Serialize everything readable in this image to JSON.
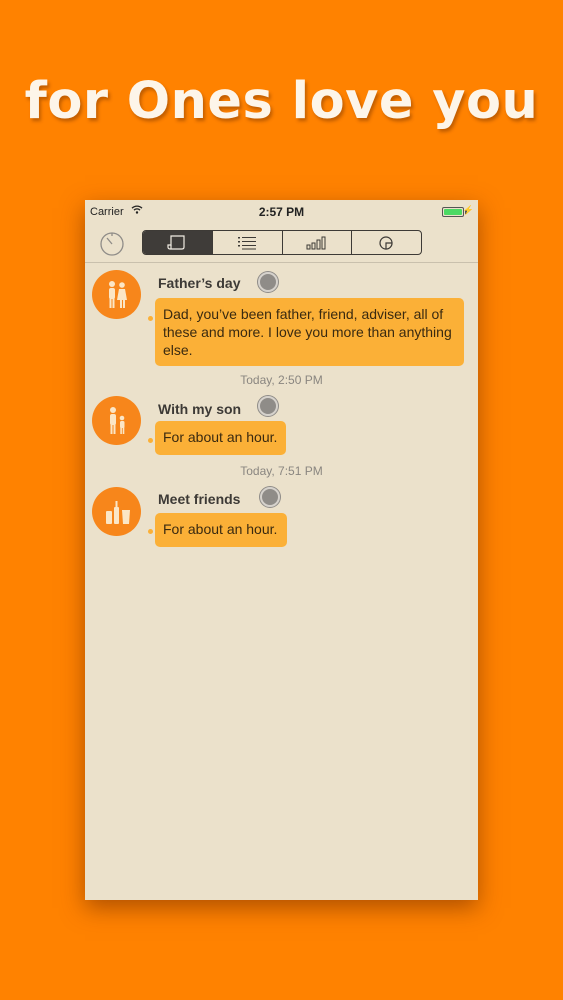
{
  "headline": "for Ones love you",
  "status_bar": {
    "carrier": "Carrier",
    "time": "2:57 PM"
  },
  "toolbar": {
    "tabs": [
      {
        "icon": "journal-icon",
        "active": true
      },
      {
        "icon": "list-icon",
        "active": false
      },
      {
        "icon": "bar-chart-icon",
        "active": false
      },
      {
        "icon": "pie-chart-icon",
        "active": false
      }
    ]
  },
  "entries": [
    {
      "title": "Father’s day",
      "text": "Dad, you’ve been father, friend, adviser, all of these and more. I love you more than anything else.",
      "avatar": "family-icon"
    },
    {
      "title": "With my son",
      "text": "For about an hour.",
      "avatar": "parent-child-icon"
    },
    {
      "title": "Meet friends",
      "text": "For about an hour.",
      "avatar": "drinks-icon"
    }
  ],
  "timestamps": [
    "Today, 2:50 PM",
    "Today, 7:51 PM"
  ],
  "colors": {
    "background": "#ff8200",
    "card": "#ebe1cb",
    "bubble": "#fbb037",
    "avatar": "#f7861b"
  }
}
